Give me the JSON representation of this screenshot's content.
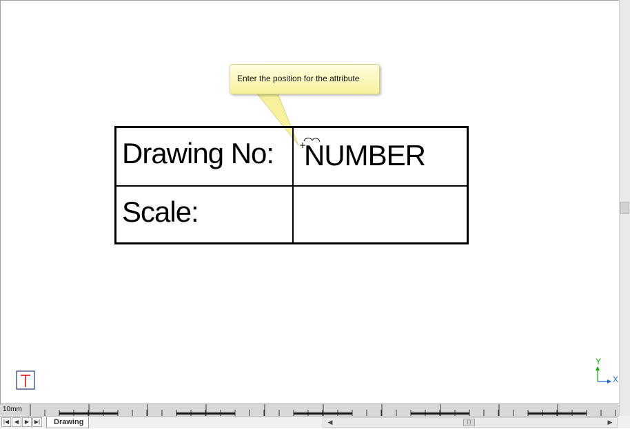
{
  "tooltip": {
    "text": "Enter the position for the attribute"
  },
  "title_block": {
    "drawing_no_label": "Drawing No:",
    "drawing_no_value": "NUMBER",
    "scale_label": "Scale:",
    "scale_value": ""
  },
  "ruler": {
    "scale_label": "10mm"
  },
  "tabs": [
    {
      "label": "Drawing"
    }
  ],
  "nav_buttons": {
    "first": "|◀",
    "prev": "◀",
    "next": "▶",
    "last": "▶|"
  },
  "ucs": {
    "y_label": "Y",
    "x_label": "X"
  },
  "colors": {
    "tooltip_bg": "#f6f19a",
    "axis_green": "#00b000",
    "axis_blue": "#1a6bdc",
    "paper_icon_red": "#e00000"
  }
}
